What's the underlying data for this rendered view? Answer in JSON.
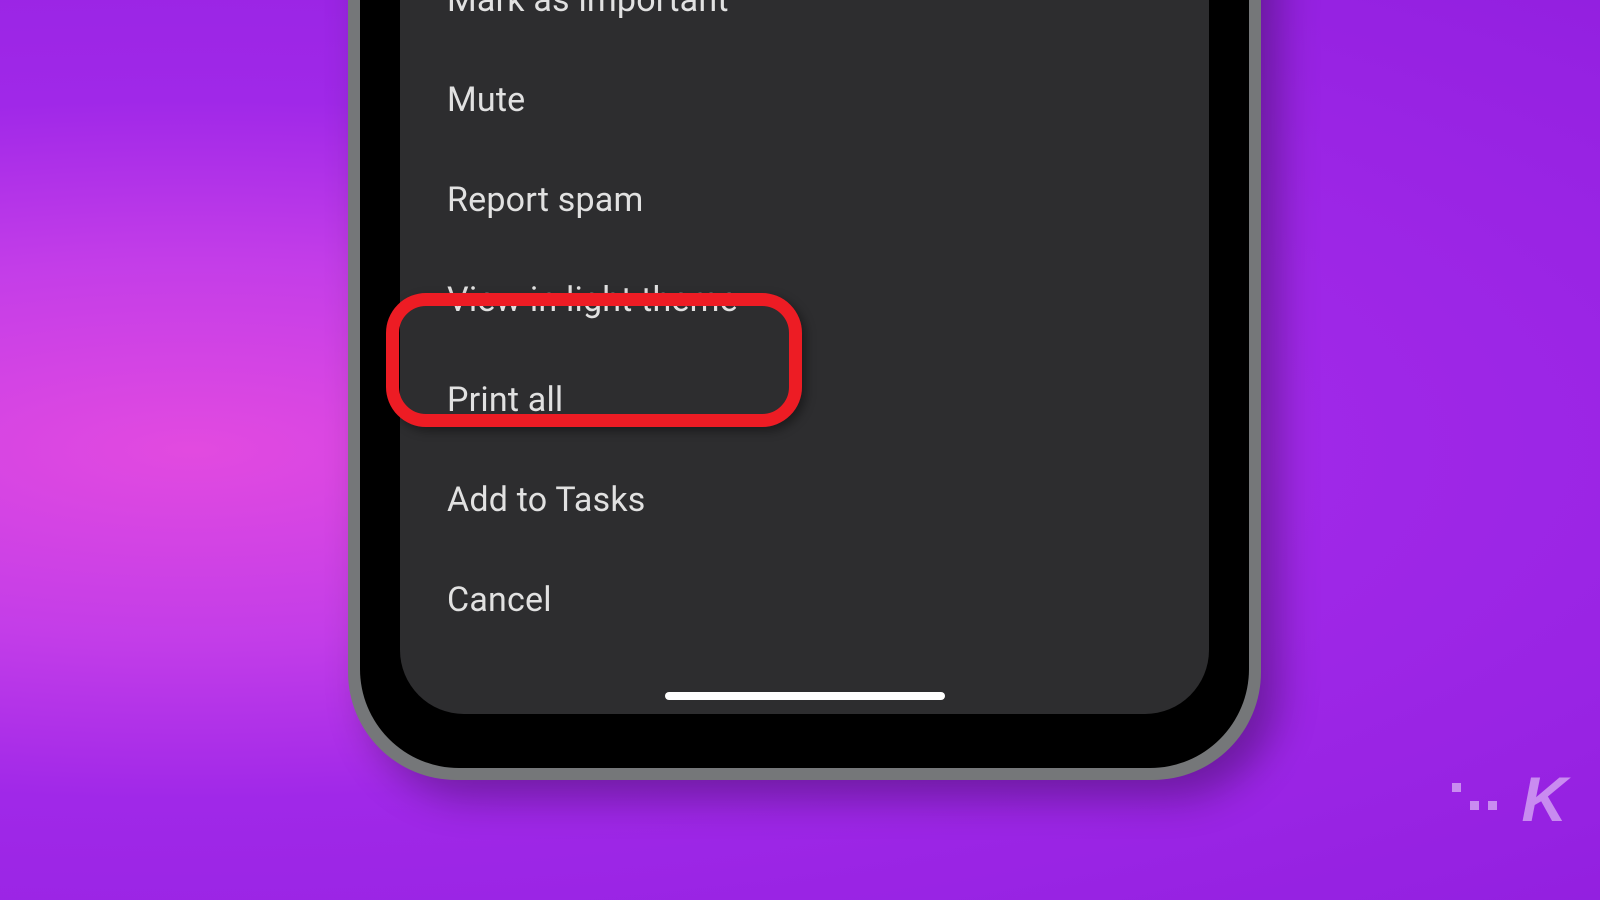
{
  "menu": {
    "items": [
      {
        "label": "Mark as important"
      },
      {
        "label": "Mute"
      },
      {
        "label": "Report spam"
      },
      {
        "label": "View in light theme"
      },
      {
        "label": "Print all"
      },
      {
        "label": "Add to Tasks"
      },
      {
        "label": "Cancel"
      }
    ]
  },
  "watermark": {
    "text": "K"
  },
  "colors": {
    "highlight": "#ed1c24",
    "screen_bg": "#2d2d2f",
    "text": "#e1e1e1"
  }
}
